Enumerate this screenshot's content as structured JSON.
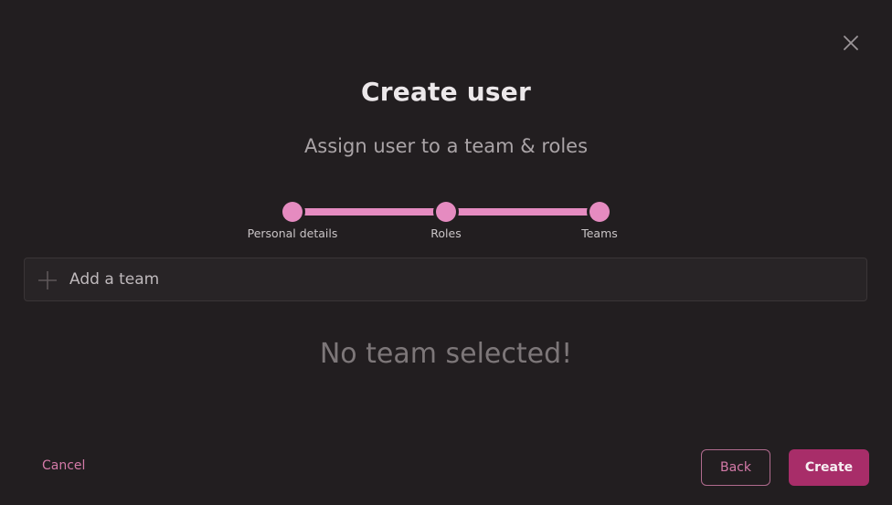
{
  "dialog": {
    "title": "Create user",
    "subtitle": "Assign user to a team & roles",
    "close_icon": "close-icon"
  },
  "stepper": {
    "steps": [
      {
        "label": "Personal details"
      },
      {
        "label": "Roles"
      },
      {
        "label": "Teams"
      }
    ],
    "current_step": 3,
    "accent_color": "#e58bc0"
  },
  "team_picker": {
    "add_label": "Add a team",
    "add_icon": "plus-icon",
    "empty_message": "No team selected!"
  },
  "footer": {
    "cancel_label": "Cancel",
    "back_label": "Back",
    "create_label": "Create",
    "primary_color": "#a82d69"
  }
}
